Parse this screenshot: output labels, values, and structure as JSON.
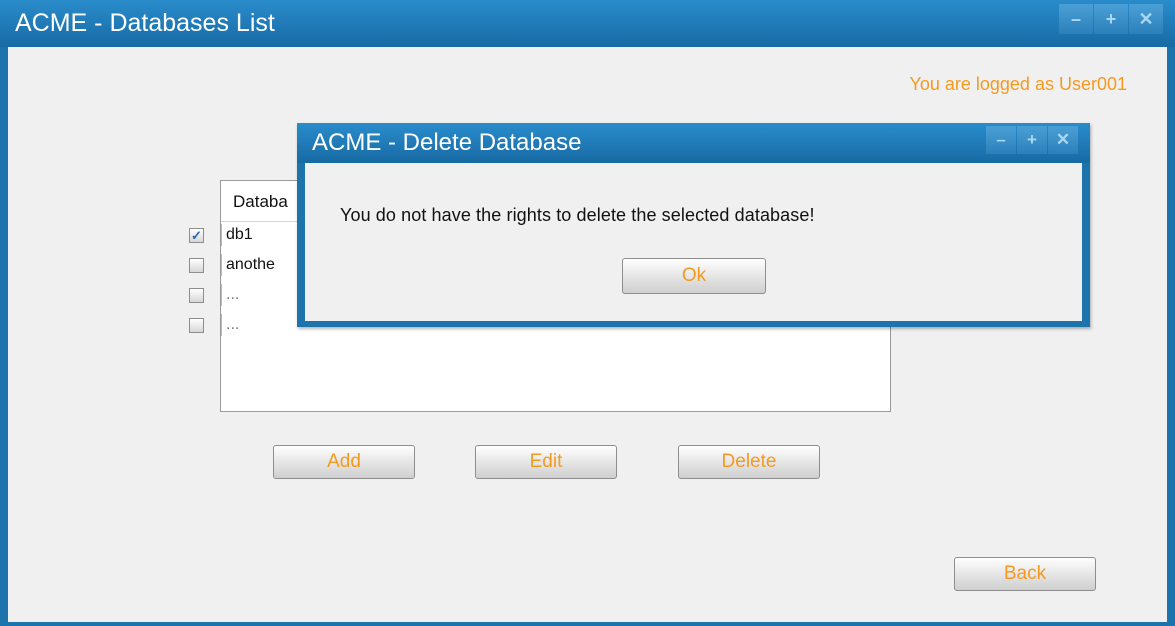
{
  "main_window": {
    "title": "ACME - Databases List",
    "controls": {
      "minimize": "–",
      "maximize": "+",
      "close": "✕"
    },
    "login_text": "You are logged as User001"
  },
  "database_list": {
    "header": "Databa",
    "rows": [
      {
        "label": "db1",
        "checked": true,
        "check": "✓"
      },
      {
        "label": "anothe",
        "checked": false,
        "check": ""
      },
      {
        "label": "...",
        "checked": false,
        "check": ""
      },
      {
        "label": "...",
        "checked": false,
        "check": ""
      }
    ]
  },
  "buttons": {
    "add": "Add",
    "edit": "Edit",
    "delete": "Delete",
    "back": "Back"
  },
  "dialog": {
    "title": "ACME - Delete Database",
    "controls": {
      "minimize": "–",
      "maximize": "+",
      "close": "✕"
    },
    "message": "You do not have the rights to delete the selected database!",
    "ok": "Ok"
  },
  "colors": {
    "accent": "#f59a1f",
    "titlebar": "#1d74ad",
    "background": "#f0f0f0"
  }
}
